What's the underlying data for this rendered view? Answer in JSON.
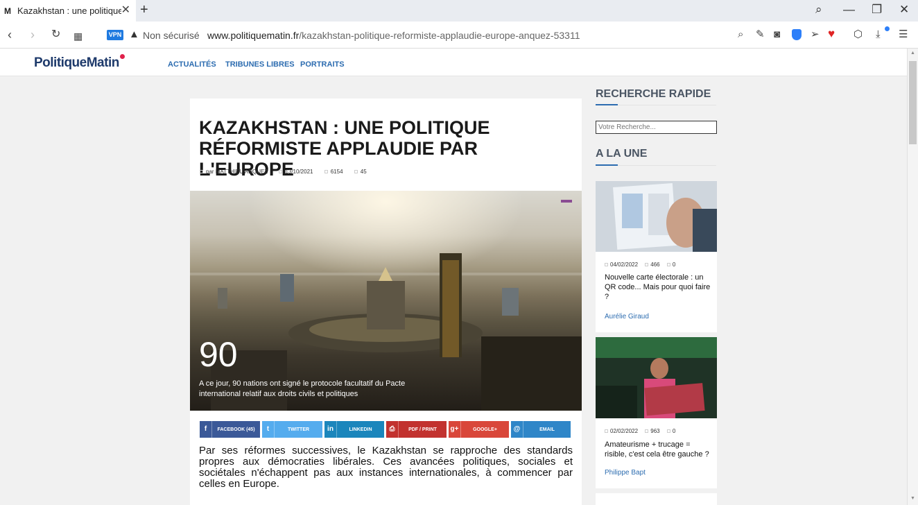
{
  "browser": {
    "tab_title": "Kazakhstan : une politique",
    "tab_favicon": "M",
    "vpn_label": "VPN",
    "security_label": "Non sécurisé",
    "url_host": "www.politiquematin.fr",
    "url_path": "/kazakhstan-politique-reformiste-applaudie-europe-anquez-53311",
    "icons": [
      "back-icon",
      "forward-icon",
      "reload-icon",
      "tabs-grid-icon",
      "search-icon",
      "share-icon",
      "camera-icon",
      "shield-icon",
      "send-icon",
      "heart-icon",
      "box-icon",
      "download-icon",
      "menu-icon"
    ]
  },
  "site": {
    "logo": "PolitiqueMatin",
    "nav": [
      "ACTUALITÉS",
      "TRIBUNES LIBRES",
      "PORTRAITS"
    ]
  },
  "article": {
    "title": "KAZAKHSTAN : UNE POLITIQUE RÉFORMISTE APPLAUDIE PAR L'EUROPE",
    "author": "par MATTHIEU ANQUEZ",
    "date": "13/10/2021",
    "views": "6154",
    "comments": "45",
    "hero_number": "90",
    "hero_caption": "A ce jour, 90 nations ont signé le protocole facultatif du Pacte international relatif aux droits civils et politiques",
    "share": [
      {
        "label": "FACEBOOK (45)",
        "color": "#3b5998",
        "icon": "f"
      },
      {
        "label": "TWITTER",
        "color": "#55acee",
        "icon": "t"
      },
      {
        "label": "LINKEDIN",
        "color": "#1b86bc",
        "icon": "in"
      },
      {
        "label": "PDF / PRINT",
        "color": "#c2322f",
        "icon": "⎙"
      },
      {
        "label": "GOOGLE+",
        "color": "#d9473a",
        "icon": "g+"
      },
      {
        "label": "EMAIL",
        "color": "#2f86c8",
        "icon": "@"
      }
    ],
    "lead": "Par ses réformes successives, le Kazakhstan se rapproche des standards propres aux démocraties libérales. Ces avancées politiques, sociales et sociétales n'échappent pas aux instances internationales, à commencer par celles en Europe."
  },
  "sidebar": {
    "search_heading": "RECHERCHE RAPIDE",
    "search_placeholder": "Votre Recherche...",
    "featured_heading": "A LA UNE",
    "cards": [
      {
        "date": "04/02/2022",
        "views": "466",
        "comments": "0",
        "title": "Nouvelle carte électorale : un QR code... Mais pour quoi faire ?",
        "author": "Aurélie Giraud"
      },
      {
        "date": "02/02/2022",
        "views": "963",
        "comments": "0",
        "title": "Amateurisme + trucage = risible, c'est cela être gauche ?",
        "author": "Philippe Bapt"
      }
    ]
  }
}
